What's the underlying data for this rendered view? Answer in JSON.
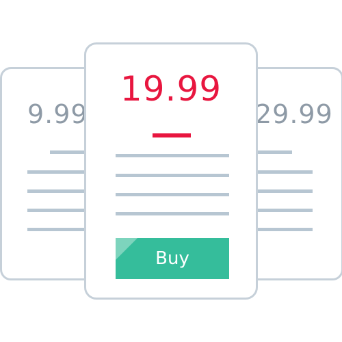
{
  "plans": [
    {
      "price": "9.99"
    },
    {
      "price": "19.99",
      "cta_label": "Buy"
    },
    {
      "price": "29.99"
    }
  ],
  "colors": {
    "accent": "#e8163f",
    "button": "#35bd9b",
    "muted_text": "#8e9aa6",
    "card_border": "#c6d0d9",
    "placeholder_line": "#b7c6d2"
  }
}
